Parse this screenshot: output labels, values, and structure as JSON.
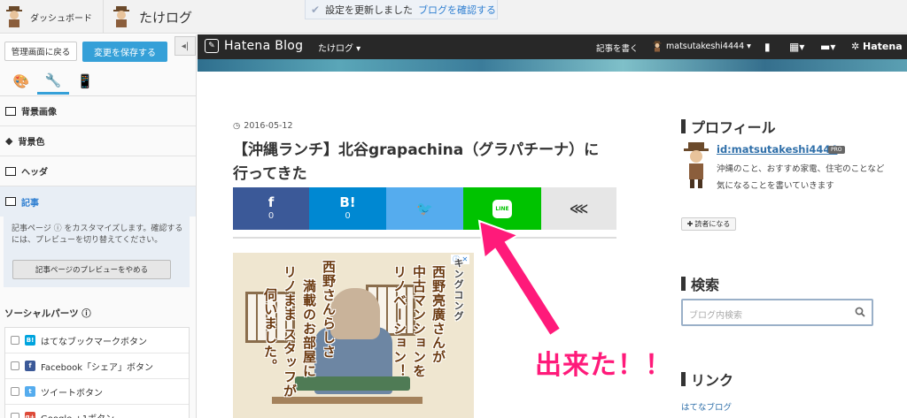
{
  "topbar": {
    "dashboard_label": "ダッシュボード",
    "blog_name": "たけログ",
    "notice_text": "設定を更新しました",
    "notice_link": "ブログを確認する"
  },
  "sidebar": {
    "back_label": "管理画面に戻る",
    "save_label": "変更を保存する",
    "collapse_symbol": "◂|",
    "menu": [
      {
        "label": "背景画像"
      },
      {
        "label": "背景色"
      },
      {
        "label": "ヘッダ"
      },
      {
        "label": "記事"
      }
    ],
    "article_desc": "記事ページ ⓘ をカスタマイズします。確認するには、プレビューを切り替えてください。",
    "preview_button": "記事ページのプレビューをやめる",
    "social_title": "ソーシャルパーツ ⓘ",
    "social_items": [
      {
        "label": "はてなブックマークボタン",
        "icon": "B!",
        "color": "#00a4de"
      },
      {
        "label": "Facebook「シェア」ボタン",
        "icon": "f",
        "color": "#3b5998"
      },
      {
        "label": "ツイートボタン",
        "icon": "t",
        "color": "#55acee"
      },
      {
        "label": "Google +1ボタン",
        "icon": "g+",
        "color": "#dd4b39"
      }
    ]
  },
  "blog_header": {
    "logo_text": "Hatena Blog",
    "blog_name": "たけログ ▾",
    "write_label": "記事を書く",
    "user_name": "matsutakeshi4444 ▾",
    "hatena_label": "Hatena"
  },
  "post": {
    "date": "2016-05-12",
    "title": "【沖縄ランチ】北谷grapachina（グラパチーナ）に行ってきた"
  },
  "share_buttons": [
    {
      "name": "facebook",
      "glyph": "f",
      "count": "0",
      "color": "#3b5998",
      "width": 86
    },
    {
      "name": "hatebu",
      "glyph": "B!",
      "count": "0",
      "color": "#0088d2",
      "width": 87
    },
    {
      "name": "twitter",
      "glyph": "🐦",
      "count": "",
      "color": "#55acee",
      "width": 87
    },
    {
      "name": "line",
      "glyph": "LINE",
      "count": "",
      "color": "#00c300",
      "width": 88
    },
    {
      "name": "share",
      "glyph": "⋘",
      "count": "",
      "color": "#e6e6e6",
      "width": 85
    }
  ],
  "ad": {
    "columns": [
      "キングコング",
      "西野亮廣さんが",
      "中古マンションを",
      "リノベーション！",
      "西野さんらしさ",
      "満載のお部屋に",
      "リノまま スタッフが",
      "伺いました。"
    ],
    "choices": "ⓘ ✕"
  },
  "annotation": "出来た！！",
  "profile": {
    "title": "プロフィール",
    "id": "id:matsutakeshi4444",
    "badge": "PRO",
    "desc": "沖縄のこと、おすすめ家電、住宅のことなど気になることを書いていきます",
    "reader_button": "読者になる"
  },
  "search": {
    "title": "検索",
    "placeholder": "ブログ内検索"
  },
  "links": {
    "title": "リンク",
    "items": [
      "はてなブログ"
    ]
  }
}
